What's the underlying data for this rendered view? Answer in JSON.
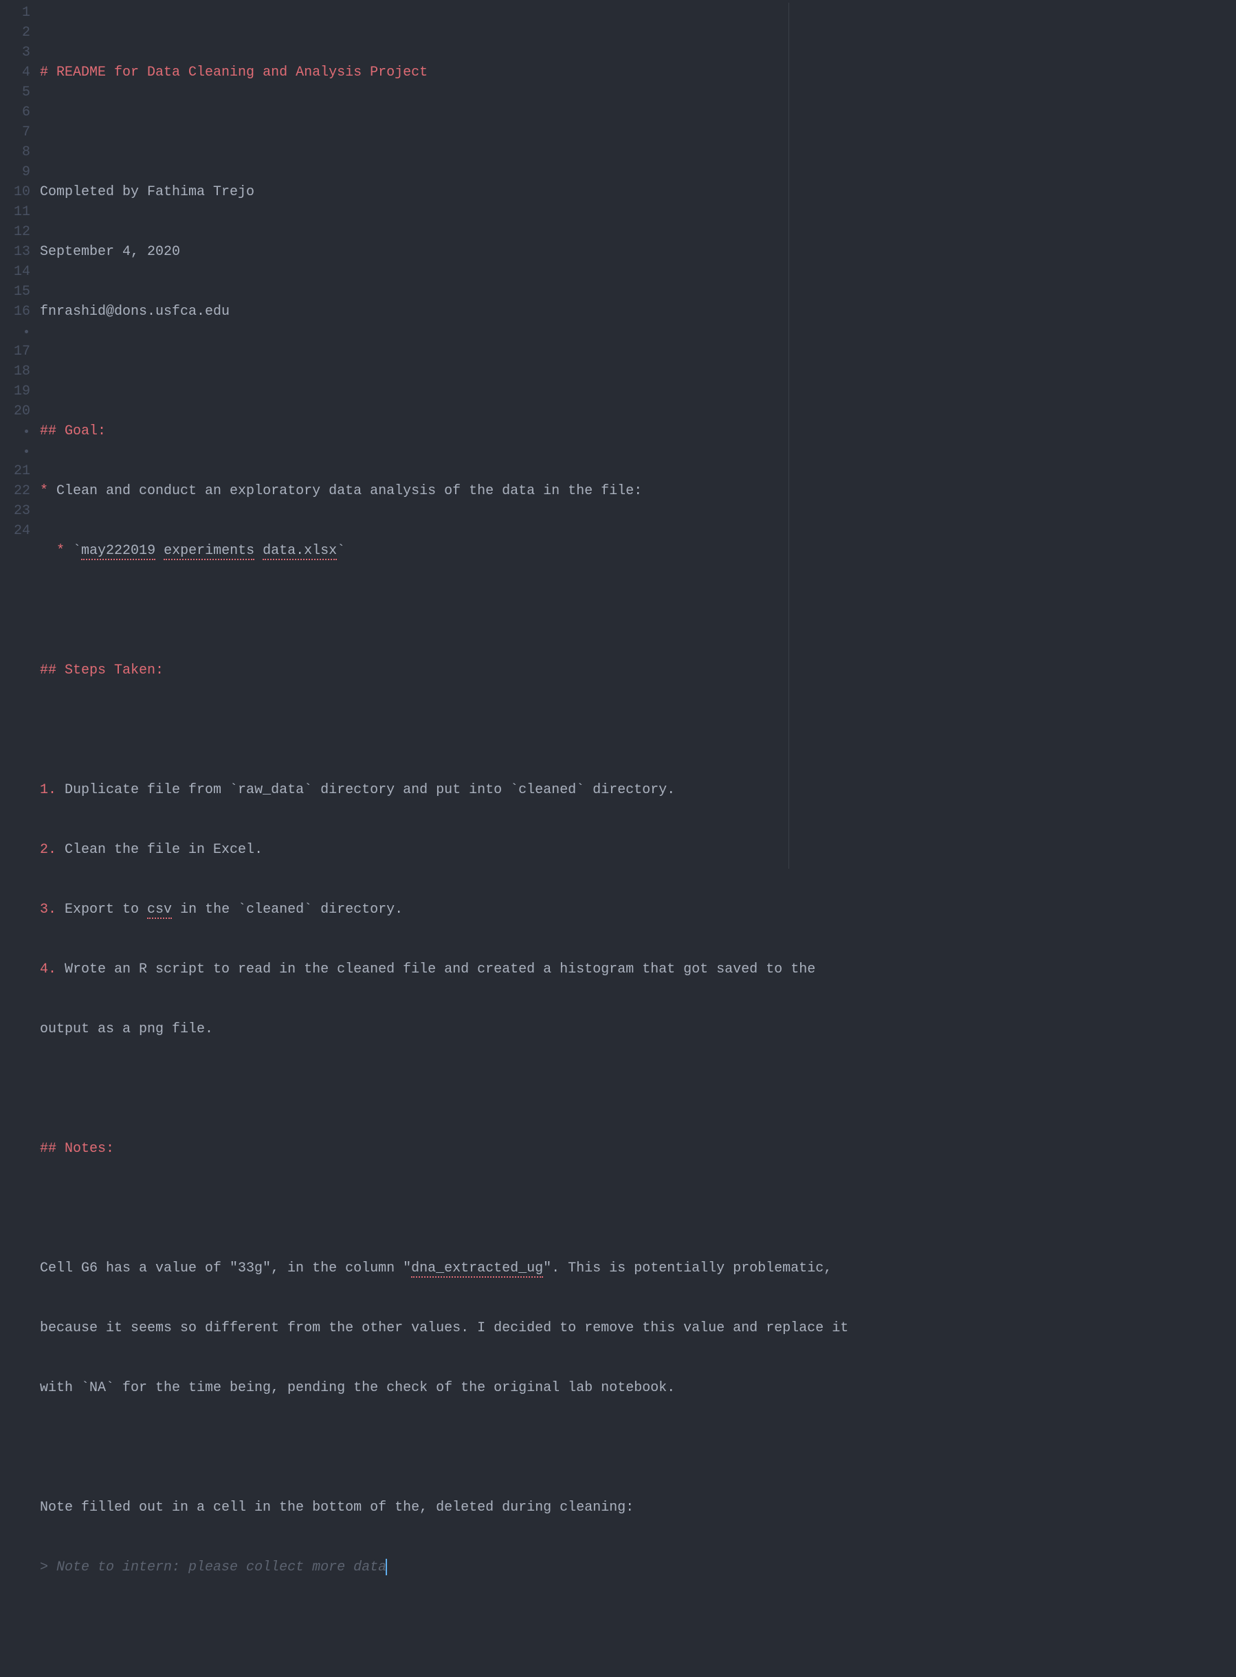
{
  "gutter": {
    "rows": [
      {
        "type": "num",
        "v": "1"
      },
      {
        "type": "num",
        "v": "2"
      },
      {
        "type": "num",
        "v": "3"
      },
      {
        "type": "num",
        "v": "4"
      },
      {
        "type": "num",
        "v": "5"
      },
      {
        "type": "num",
        "v": "6"
      },
      {
        "type": "num",
        "v": "7"
      },
      {
        "type": "num",
        "v": "8"
      },
      {
        "type": "num",
        "v": "9"
      },
      {
        "type": "num",
        "v": "10"
      },
      {
        "type": "num",
        "v": "11"
      },
      {
        "type": "num",
        "v": "12"
      },
      {
        "type": "num",
        "v": "13"
      },
      {
        "type": "num",
        "v": "14"
      },
      {
        "type": "num",
        "v": "15"
      },
      {
        "type": "num",
        "v": "16"
      },
      {
        "type": "dot",
        "v": "•"
      },
      {
        "type": "num",
        "v": "17"
      },
      {
        "type": "num",
        "v": "18"
      },
      {
        "type": "num",
        "v": "19"
      },
      {
        "type": "num",
        "v": "20"
      },
      {
        "type": "dot",
        "v": "•"
      },
      {
        "type": "dot",
        "v": "•"
      },
      {
        "type": "num",
        "v": "21"
      },
      {
        "type": "num",
        "v": "22"
      },
      {
        "type": "num",
        "v": "23"
      },
      {
        "type": "num",
        "v": "24"
      }
    ]
  },
  "lines": {
    "l1_hash": "# ",
    "l1_rest": "README for Data Cleaning and Analysis Project",
    "l3": "Completed by Fathima Trejo",
    "l4": "September 4, 2020",
    "l5": "fnrashid@dons.usfca.edu",
    "l7_hash": "## ",
    "l7_rest": "Goal:",
    "l8_bullet": "* ",
    "l8_text": "Clean and conduct an exploratory data analysis of the data in the file:",
    "l9_indent": "  ",
    "l9_bullet": "* ",
    "l9_tick1": "`",
    "l9_w1": "may222019",
    "l9_sp1": " ",
    "l9_w2": "experiments",
    "l9_sp2": " ",
    "l9_w3": "data.xlsx",
    "l9_tick2": "`",
    "l11_hash": "## ",
    "l11_rest": "Steps Taken:",
    "l13_num": "1.",
    "l13_text": " Duplicate file from `raw_data` directory and put into `cleaned` directory.",
    "l14_num": "2.",
    "l14_text": " Clean the file in Excel.",
    "l15_num": "3.",
    "l15_a": " Export to ",
    "l15_csv": "csv",
    "l15_b": " in the `cleaned` directory.",
    "l16_num": "4.",
    "l16_text": " Wrote an R script to read in the cleaned file and created a histogram that got saved to the ",
    "l16b": "output as a png file.",
    "l18_hash": "## ",
    "l18_rest": "Notes:",
    "l20_a": "Cell G6 has a value of \"33g\", in the column \"",
    "l20_dna": "dna_extracted_ug",
    "l20_b": "\". This is potentially problematic, ",
    "l20c": "because it seems so different from the other values. I decided to remove this value and replace it ",
    "l20d": "with `NA` for the time being, pending the check of the original lab notebook.",
    "l22": "Note filled out in a cell in the bottom of the, deleted during cleaning:",
    "l23_gt": "> ",
    "l23_text": "Note to intern: please collect more data"
  }
}
